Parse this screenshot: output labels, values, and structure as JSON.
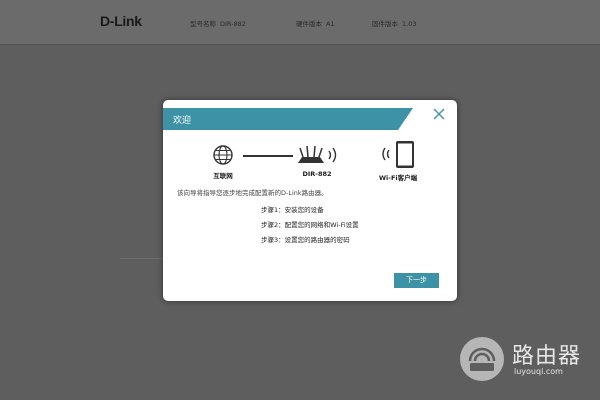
{
  "header": {
    "brand": "D-Link",
    "model_label": "型号名称",
    "model_value": "DIR-882",
    "hw_label": "硬件版本",
    "hw_value": "A1",
    "fw_label": "固件版本",
    "fw_value": "1.03"
  },
  "dialog": {
    "title": "欢迎",
    "internet_label": "互联网",
    "router_label": "DIR-882",
    "client_label": "Wi-Fi客户端",
    "intro": "该向导将指导您逐步地完成配置新的D-Link路由器。",
    "steps": [
      "步骤1：安装您的设备",
      "步骤2：配置您的网络和Wi-Fi设置",
      "步骤3：设置您的路由器的密码"
    ],
    "next_label": "下一步"
  },
  "watermark": {
    "cn": "路由器",
    "en": "luyouqi.com"
  },
  "colors": {
    "accent": "#3d93a5",
    "overlay": "#5e5e5e"
  },
  "icons": [
    "globe-icon",
    "router-icon",
    "wifi-signal-icon",
    "tablet-icon",
    "close-icon",
    "router-logo-icon"
  ]
}
